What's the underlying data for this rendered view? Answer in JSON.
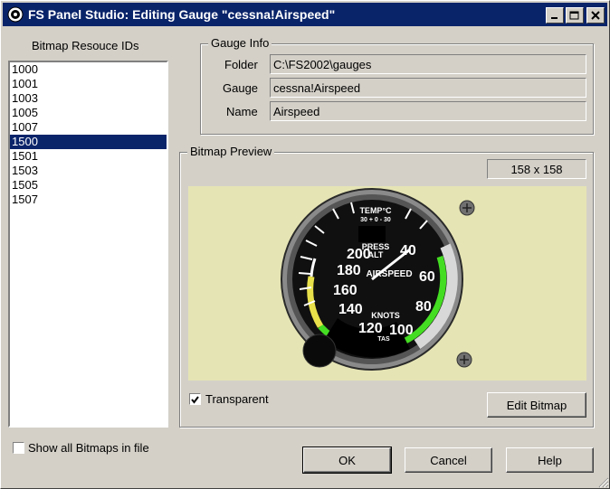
{
  "window": {
    "title": "FS Panel Studio: Editing Gauge \"cessna!Airspeed\""
  },
  "left": {
    "header": "Bitmap Resouce IDs",
    "items": [
      "1000",
      "1001",
      "1003",
      "1005",
      "1007",
      "1500",
      "1501",
      "1503",
      "1505",
      "1507"
    ],
    "selected": "1500",
    "show_all_label": "Show all Bitmaps in file",
    "show_all_checked": false
  },
  "gauge_info": {
    "title": "Gauge Info",
    "folder_label": "Folder",
    "folder_value": "C:\\FS2002\\gauges",
    "gauge_label": "Gauge",
    "gauge_value": "cessna!Airspeed",
    "name_label": "Name",
    "name_value": "Airspeed"
  },
  "bitmap_preview": {
    "title": "Bitmap Preview",
    "size": "158 x 158",
    "transparent_label": "Transparent",
    "transparent_checked": true,
    "edit_button": "Edit Bitmap",
    "bg_color": "#e5e4b4",
    "gauge": {
      "top_label": "TEMP°C",
      "temp_scale": "30 + 0 - 30",
      "press_label": "PRESS",
      "alt_label": "ALT",
      "title": "AIRSPEED",
      "units": "KNOTS",
      "tas": "TAS",
      "numbers": [
        "200",
        "180",
        "160",
        "140",
        "120",
        "100",
        "80",
        "60",
        "40"
      ]
    }
  },
  "buttons": {
    "ok": "OK",
    "cancel": "Cancel",
    "help": "Help"
  }
}
